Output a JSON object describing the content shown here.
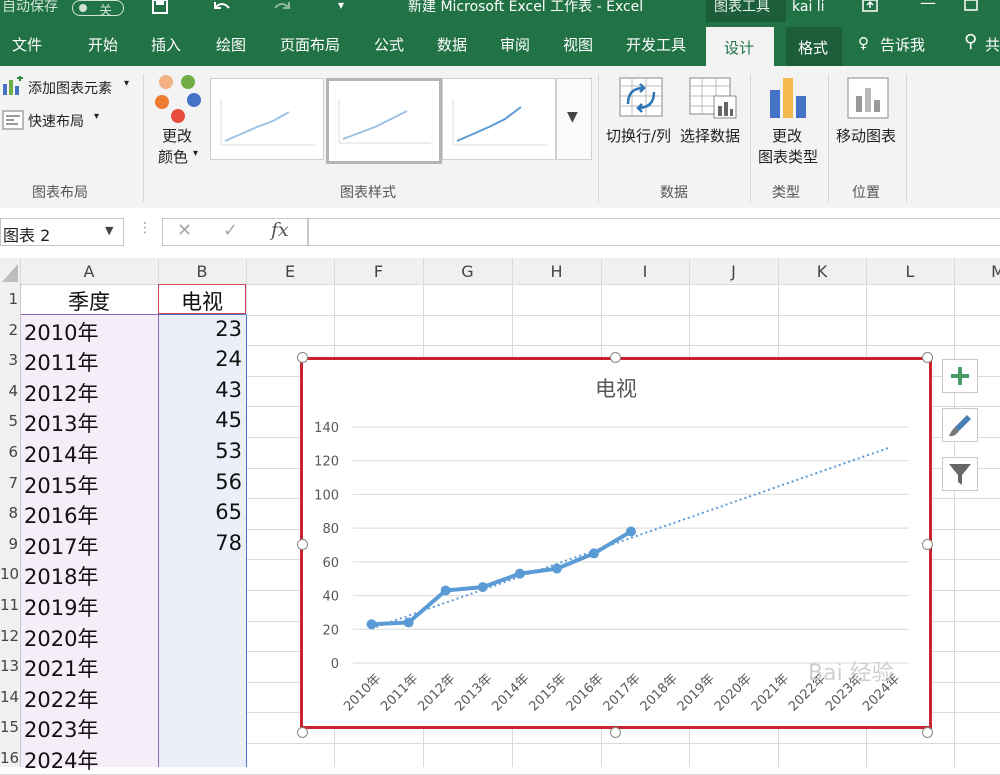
{
  "titlebar": {
    "autosave": "自动保存",
    "autosave_state": "关",
    "title": "新建 Microsoft Excel 工作表  -  Excel",
    "context_tools": "图表工具",
    "user": "kai li"
  },
  "tabs": [
    "文件",
    "开始",
    "插入",
    "绘图",
    "页面布局",
    "公式",
    "数据",
    "审阅",
    "视图",
    "开发工具",
    "设计",
    "格式"
  ],
  "tell_me": "告诉我",
  "share": "共",
  "ribbon": {
    "add_element": "添加图表元素",
    "quick_layout": "快速布局",
    "change_colors_1": "更改",
    "change_colors_2": "颜色",
    "switch_row_col": "切换行/列",
    "select_data": "选择数据",
    "change_type_1": "更改",
    "change_type_2": "图表类型",
    "move_chart": "移动图表",
    "group_layout": "图表布局",
    "group_styles": "图表样式",
    "group_data": "数据",
    "group_type": "类型",
    "group_location": "位置"
  },
  "formula_bar": {
    "name_box": "图表 2",
    "fx": "fx",
    "value": ""
  },
  "columns": [
    "A",
    "B",
    "E",
    "F",
    "G",
    "H",
    "I",
    "J",
    "K",
    "L",
    "M"
  ],
  "rows": [
    "1",
    "2",
    "3",
    "4",
    "5",
    "6",
    "7",
    "8",
    "9",
    "10",
    "11",
    "12",
    "13",
    "14",
    "15",
    "16"
  ],
  "sheet": {
    "header_a": "季度",
    "header_b": "电视",
    "col_a": [
      "2010年",
      "2011年",
      "2012年",
      "2013年",
      "2014年",
      "2015年",
      "2016年",
      "2017年",
      "2018年",
      "2019年",
      "2020年",
      "2021年",
      "2022年",
      "2023年",
      "2024年"
    ],
    "col_b": [
      "23",
      "24",
      "43",
      "45",
      "53",
      "56",
      "65",
      "78",
      "",
      "",
      "",
      "",
      "",
      "",
      ""
    ]
  },
  "chart_data": {
    "type": "line",
    "title": "电视",
    "categories": [
      "2010年",
      "2011年",
      "2012年",
      "2013年",
      "2014年",
      "2015年",
      "2016年",
      "2017年",
      "2018年",
      "2019年",
      "2020年",
      "2021年",
      "2022年",
      "2023年",
      "2024年"
    ],
    "series": [
      {
        "name": "电视",
        "values": [
          23,
          24,
          43,
          45,
          53,
          56,
          65,
          78
        ],
        "color": "#5b9bd5"
      }
    ],
    "trendline": {
      "style": "dotted",
      "color": "#5b9bd5",
      "start": 20.4,
      "end": 128.0
    },
    "yticks": [
      0,
      20,
      40,
      60,
      80,
      100,
      120,
      140
    ],
    "ylim": [
      0,
      140
    ],
    "grid": true,
    "legend": "none"
  },
  "watermark": "Bai 经验"
}
